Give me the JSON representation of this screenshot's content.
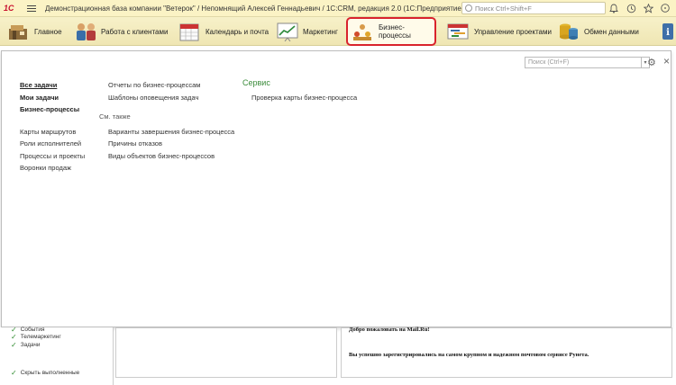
{
  "titlebar": {
    "logo": "1С",
    "title": "Демонстрационная база компании \"Ветерок\" / Непомнящий Алексей Геннадьевич / 1С:CRM, редакция 2.0  (1С:Предприятие)",
    "search_placeholder": "Поиск Ctrl+Shift+F",
    "icons": [
      "bell-icon",
      "history-icon",
      "star-icon",
      "more-icon"
    ]
  },
  "sections": [
    {
      "label": "Главное",
      "icon": "main-icon"
    },
    {
      "label": "Работа с клиентами",
      "icon": "clients-icon"
    },
    {
      "label": "Календарь и почта",
      "icon": "calendar-icon"
    },
    {
      "label": "Маркетинг",
      "icon": "marketing-icon"
    },
    {
      "label": "Бизнес-процессы",
      "icon": "business-process-icon",
      "active": true
    },
    {
      "label": "Управление проектами",
      "icon": "projects-icon"
    },
    {
      "label": "Обмен данными",
      "icon": "data-exchange-icon"
    }
  ],
  "panel": {
    "search_placeholder": "Поиск (Ctrl+F)",
    "col1": {
      "links": [
        "Все задачи",
        "Мои задачи",
        "Бизнес-процессы"
      ],
      "links2": [
        "Карты маршрутов",
        "Роли исполнителей",
        "Процессы и проекты",
        "Воронки продаж"
      ]
    },
    "col2": {
      "links": [
        "Отчеты по бизнес-процессам",
        "Шаблоны оповещения задач"
      ],
      "see_also_label": "См. также",
      "see_also": [
        "Варианты завершения бизнес-процесса",
        "Причины отказов",
        "Виды объектов бизнес-процессов"
      ]
    },
    "col3": {
      "heading": "Сервис",
      "links": [
        "Проверка карты бизнес-процесса"
      ]
    }
  },
  "background": {
    "checks": [
      "Телемаркетинг",
      "Задачи",
      "Скрыть выполненные"
    ],
    "partial_check": "События",
    "email_line1": "Добро пожаловать на Mail.Ru!",
    "email_line2": "Вы успешно зарегистрировались на самом крупном и надежном почтовом сервисе Рунета."
  }
}
